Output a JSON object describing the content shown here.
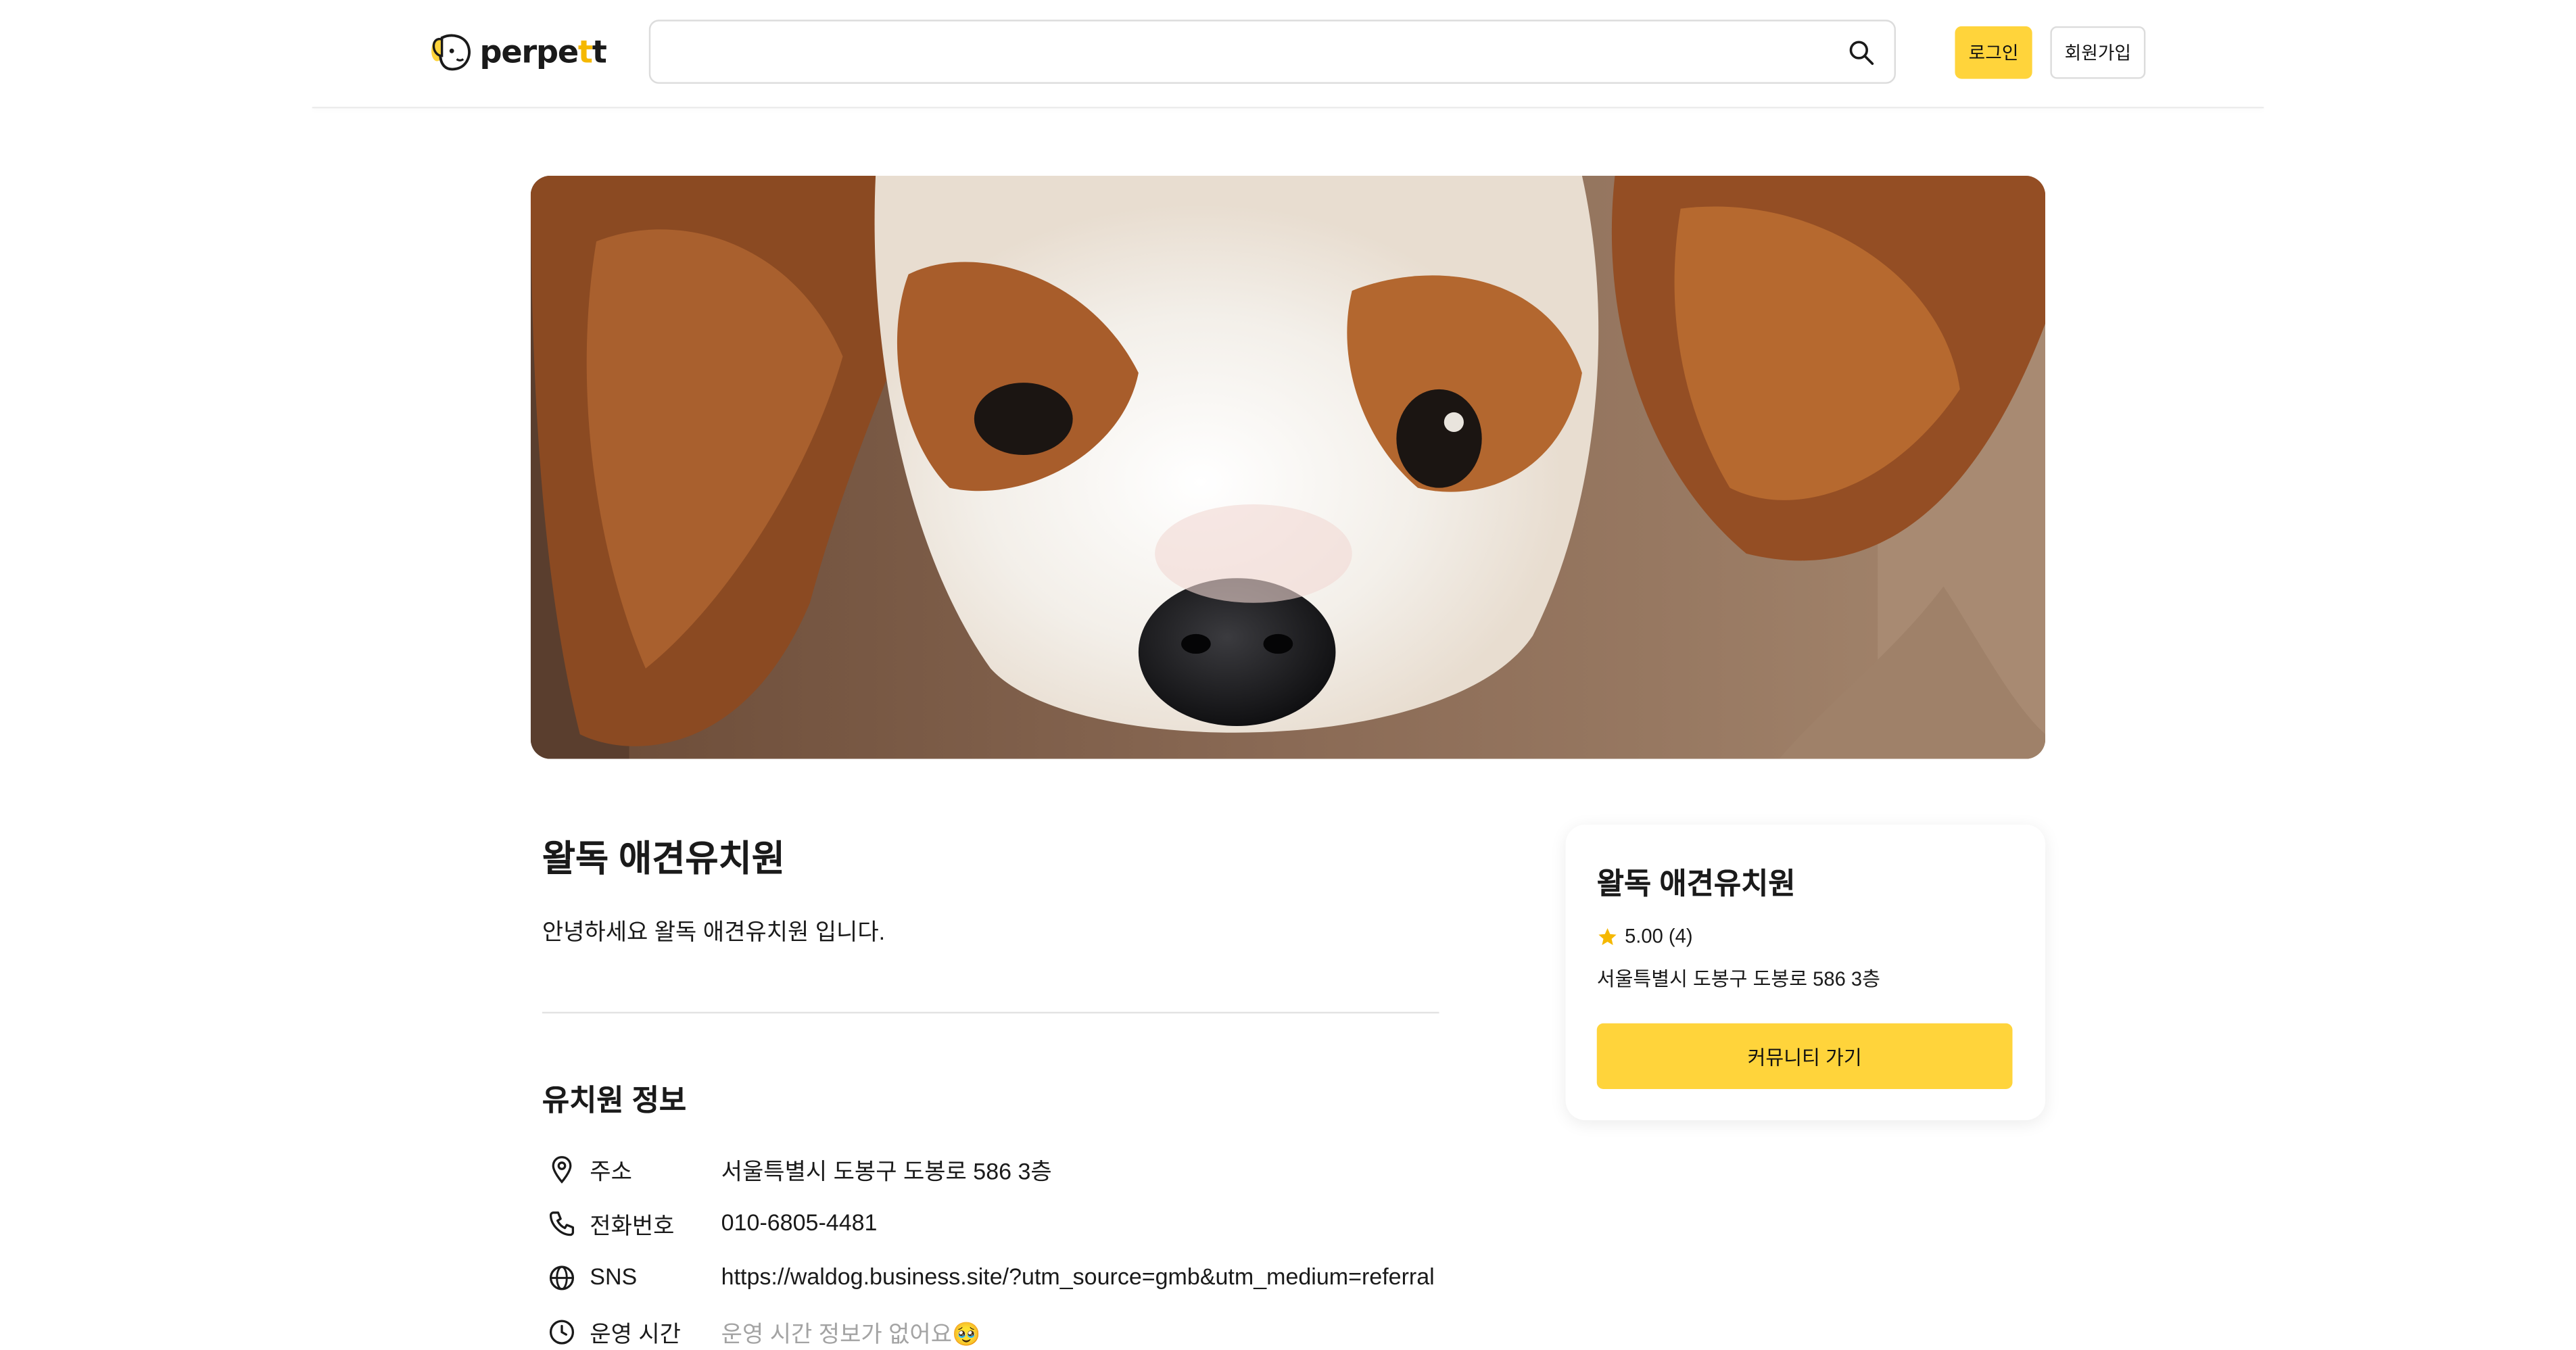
{
  "header": {
    "logo_text_main": "perpe",
    "logo_text_accent": "t",
    "logo_text_tail": "t",
    "search_placeholder": "",
    "login_label": "로그인",
    "signup_label": "회원가입"
  },
  "hero": {
    "image": "cavalier-king-charles-puppy-photo"
  },
  "main": {
    "title": "왈독 애견유치원",
    "description": "안녕하세요 왈독 애견유치원 입니다.",
    "section_title": "유치원 정보",
    "info": {
      "address_label": "주소",
      "address_value": "서울특별시 도봉구 도봉로 586 3층",
      "phone_label": "전화번호",
      "phone_value": "010-6805-4481",
      "sns_label": "SNS",
      "sns_value": "https://waldog.business.site/?utm_source=gmb&utm_medium=referral",
      "hours_label": "운영 시간",
      "hours_value": "운영 시간 정보가 없어요🥹"
    }
  },
  "card": {
    "title": "왈독 애견유치원",
    "rating": "5.00 (4)",
    "address": "서울특별시 도봉구 도봉로 586 3층",
    "button_label": "커뮤니티 가기"
  },
  "colors": {
    "accent": "#ffd43b",
    "star": "#f5b800",
    "muted_text": "#a3a3a3"
  }
}
